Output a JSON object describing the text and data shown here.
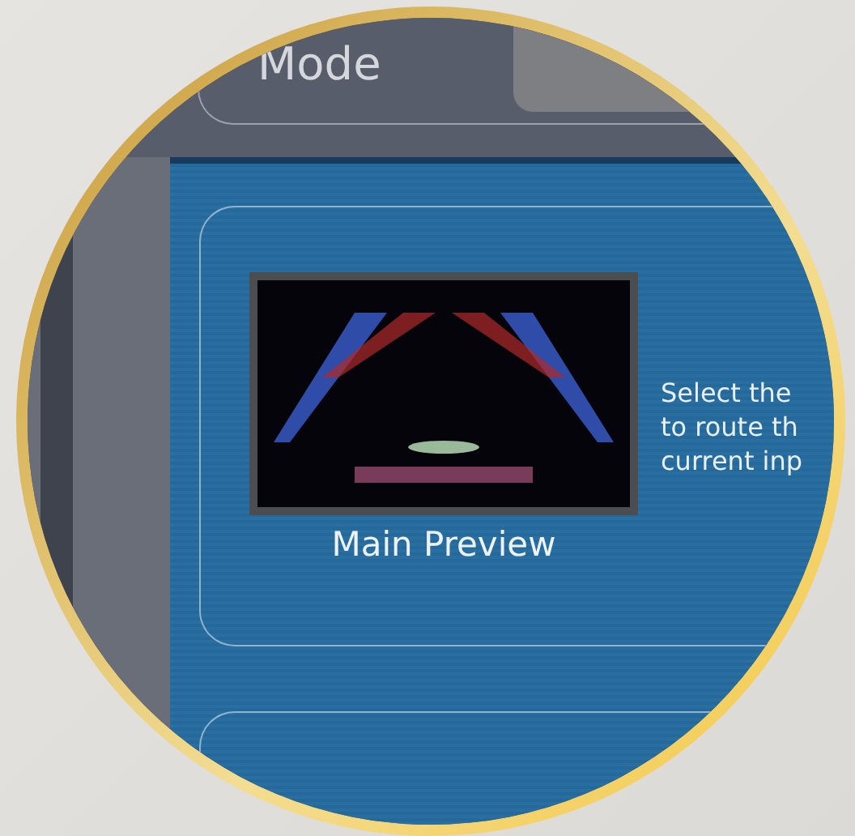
{
  "header": {
    "title": "Mode"
  },
  "preview": {
    "label": "Main Preview"
  },
  "description": {
    "lines": [
      "Select the",
      "to route th",
      "current inp"
    ]
  }
}
